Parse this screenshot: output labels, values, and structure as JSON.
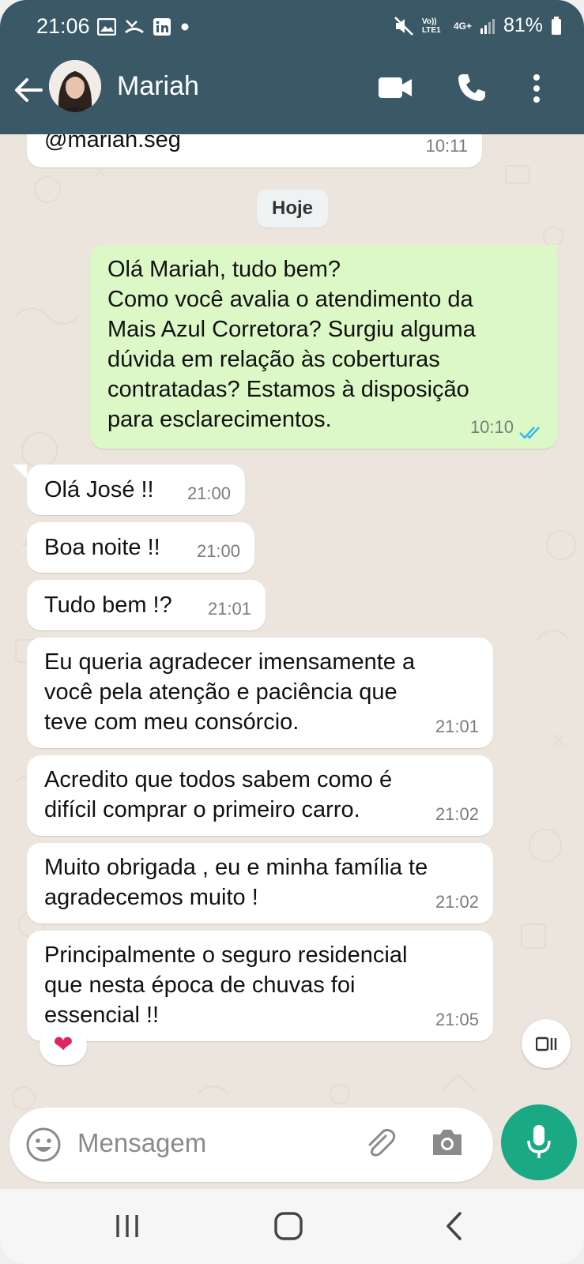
{
  "status_bar": {
    "time": "21:06",
    "battery": "81%",
    "network": "4G+",
    "volte": "Vo)) LTE1",
    "left_icons": [
      "gallery-icon",
      "missed-call-icon",
      "linkedin-icon",
      "dot-icon"
    ],
    "right_icons": [
      "mute-icon",
      "signal-icon",
      "battery-icon"
    ]
  },
  "header": {
    "contact_name": "Mariah"
  },
  "chat": {
    "partial_message": {
      "text": "@mariah.seg",
      "time": "10:11"
    },
    "date_chip": "Hoje",
    "outgoing": {
      "text": "Olá Mariah, tudo bem?\nComo você avalia o atendimento da\nMais Azul Corretora? Surgiu alguma\ndúvida em relação às coberturas\ncontratadas? Estamos à disposição\npara esclarecimentos.",
      "time": "10:10",
      "status": "read"
    },
    "incoming": [
      {
        "text": "Olá José !!",
        "time": "21:00"
      },
      {
        "text": "Boa noite !!",
        "time": "21:00"
      },
      {
        "text": "Tudo bem !?",
        "time": "21:01"
      },
      {
        "text": "Eu queria agradecer imensamente a\nvocê pela atenção e paciência que\nteve com meu consórcio.",
        "time": "21:01"
      },
      {
        "text": "Acredito que todos sabem como é\ndifícil comprar o primeiro carro.",
        "time": "21:02"
      },
      {
        "text": "Muito obrigada , eu e minha família te\nagradecemos muito !",
        "time": "21:02"
      },
      {
        "text": "Principalmente o seguro residencial\nque nesta época de chuvas foi\nessencial !!",
        "time": "21:05"
      }
    ],
    "reaction": "❤"
  },
  "input": {
    "placeholder": "Mensagem"
  },
  "colors": {
    "header": "#3b5867",
    "chat_bg": "#ece5dd",
    "outgoing_bubble": "#dcf8c6",
    "incoming_bubble": "#ffffff",
    "mic_button": "#1aa885",
    "read_ticks": "#34b7f1"
  }
}
